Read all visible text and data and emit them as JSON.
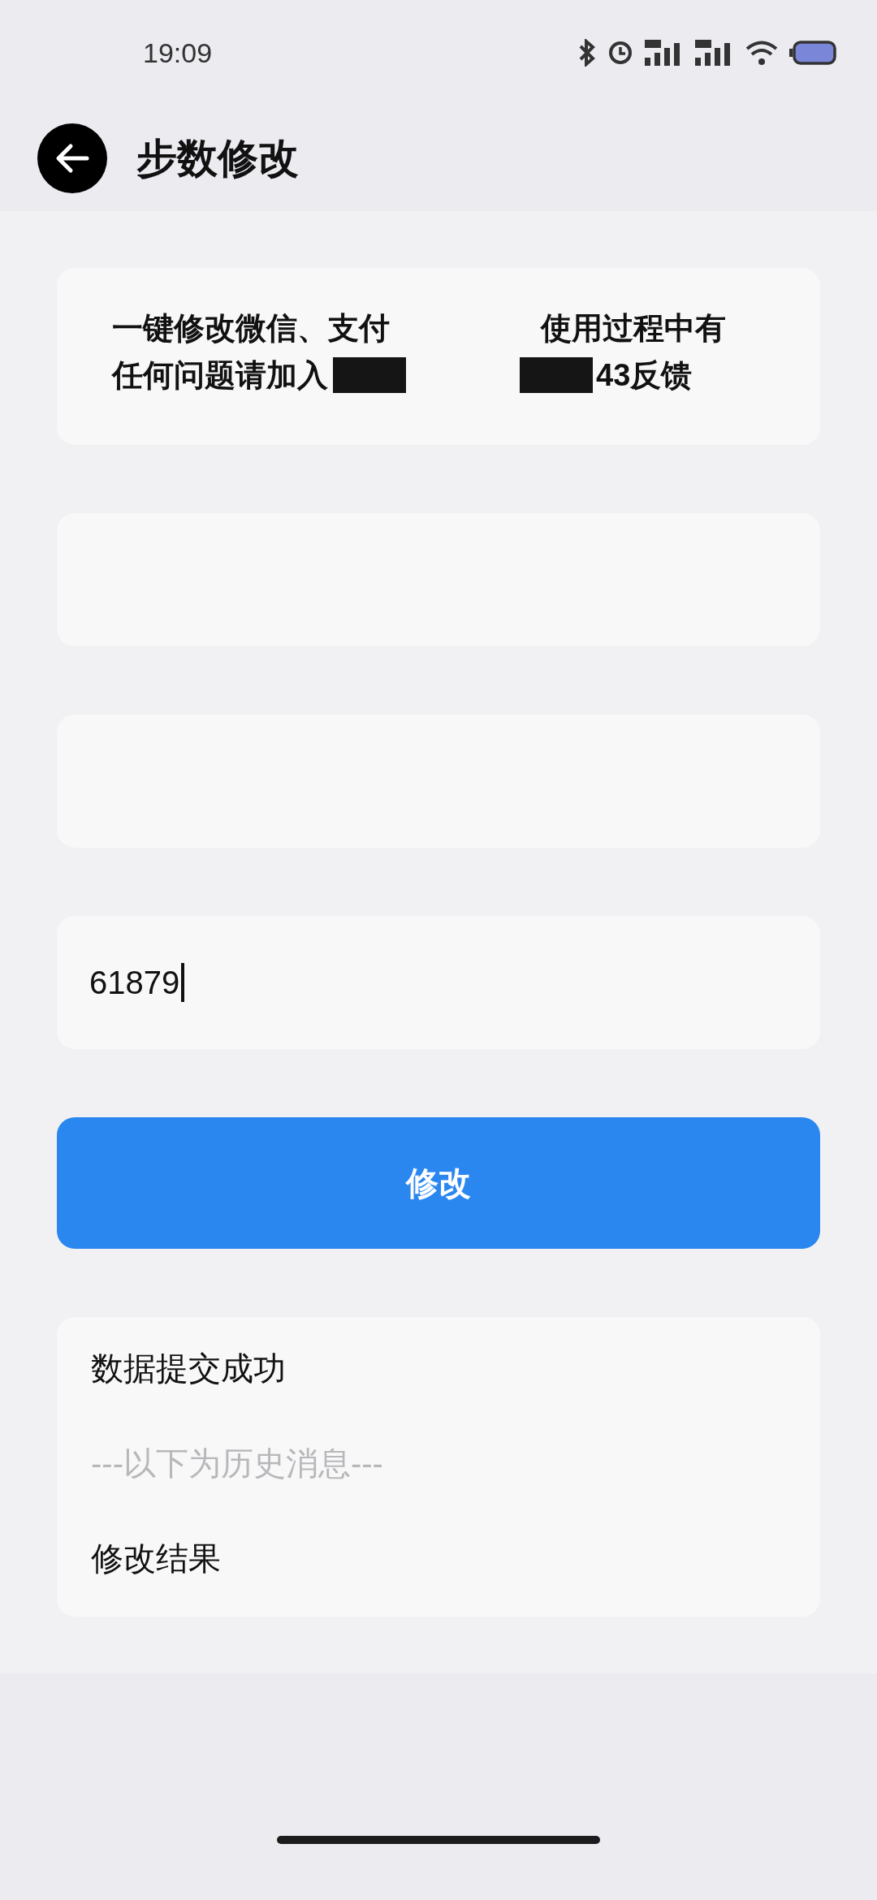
{
  "status_bar": {
    "time": "19:09"
  },
  "header": {
    "title": "步数修改"
  },
  "info": {
    "lines": [
      [
        "一键修改微信、支付",
        "使用过程中有"
      ],
      [
        "任何问题请加入",
        "43反馈"
      ]
    ]
  },
  "fields": [
    {
      "caret": false
    },
    {
      "caret": false
    },
    {
      "value": "61879",
      "caret": true
    }
  ],
  "submit_button": {
    "label": "修改"
  },
  "result": {
    "messages": [
      {
        "kind": "normal",
        "text": "数据提交成功"
      },
      {
        "kind": "divider",
        "text": "---以下为历史消息---"
      },
      {
        "kind": "normal",
        "text": "修改结果"
      }
    ]
  }
}
